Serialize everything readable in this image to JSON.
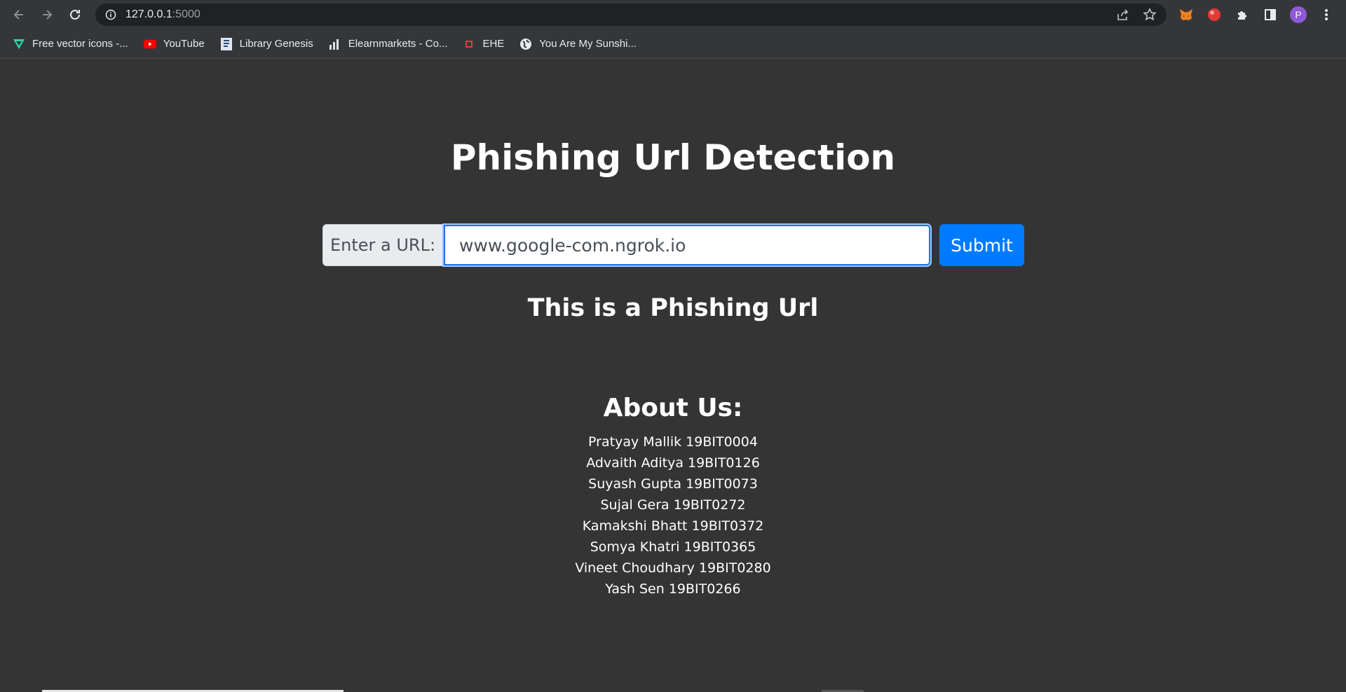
{
  "browser": {
    "url_host": "127.0.0.1",
    "url_port": ":5000",
    "profile_initial": "P",
    "bookmarks": [
      {
        "label": "Free vector icons -...",
        "icon": "flaticon-icon",
        "color": "#2ed3a4"
      },
      {
        "label": "YouTube",
        "icon": "youtube-icon",
        "color": "#ff0000"
      },
      {
        "label": "Library Genesis",
        "icon": "library-genesis-icon",
        "color": "#9db3cf"
      },
      {
        "label": "Elearnmarkets - Co...",
        "icon": "elearnmarkets-icon",
        "color": "#dfe3ea"
      },
      {
        "label": "EHE",
        "icon": "ehe-icon",
        "color": "#e33b3b"
      },
      {
        "label": "You Are My Sunshi...",
        "icon": "globe-icon",
        "color": "#e8eaed"
      }
    ]
  },
  "page": {
    "title": "Phishing Url Detection",
    "form": {
      "prepend_label": "Enter a URL:",
      "input_value": "www.google-com.ngrok.io",
      "submit_label": "Submit"
    },
    "result": "This is a Phishing Url",
    "about_title": "About Us:",
    "members": [
      "Pratyay Mallik 19BIT0004",
      "Advaith Aditya 19BIT0126",
      "Suyash Gupta 19BIT0073",
      "Sujal Gera 19BIT0272",
      "Kamakshi Bhatt 19BIT0372",
      "Somya Khatri 19BIT0365",
      "Vineet Choudhary 19BIT0280",
      "Yash Sen 19BIT0266"
    ]
  },
  "colors": {
    "page_bg": "#343434",
    "accent": "#007bff",
    "chrome_bg": "#35363a"
  }
}
